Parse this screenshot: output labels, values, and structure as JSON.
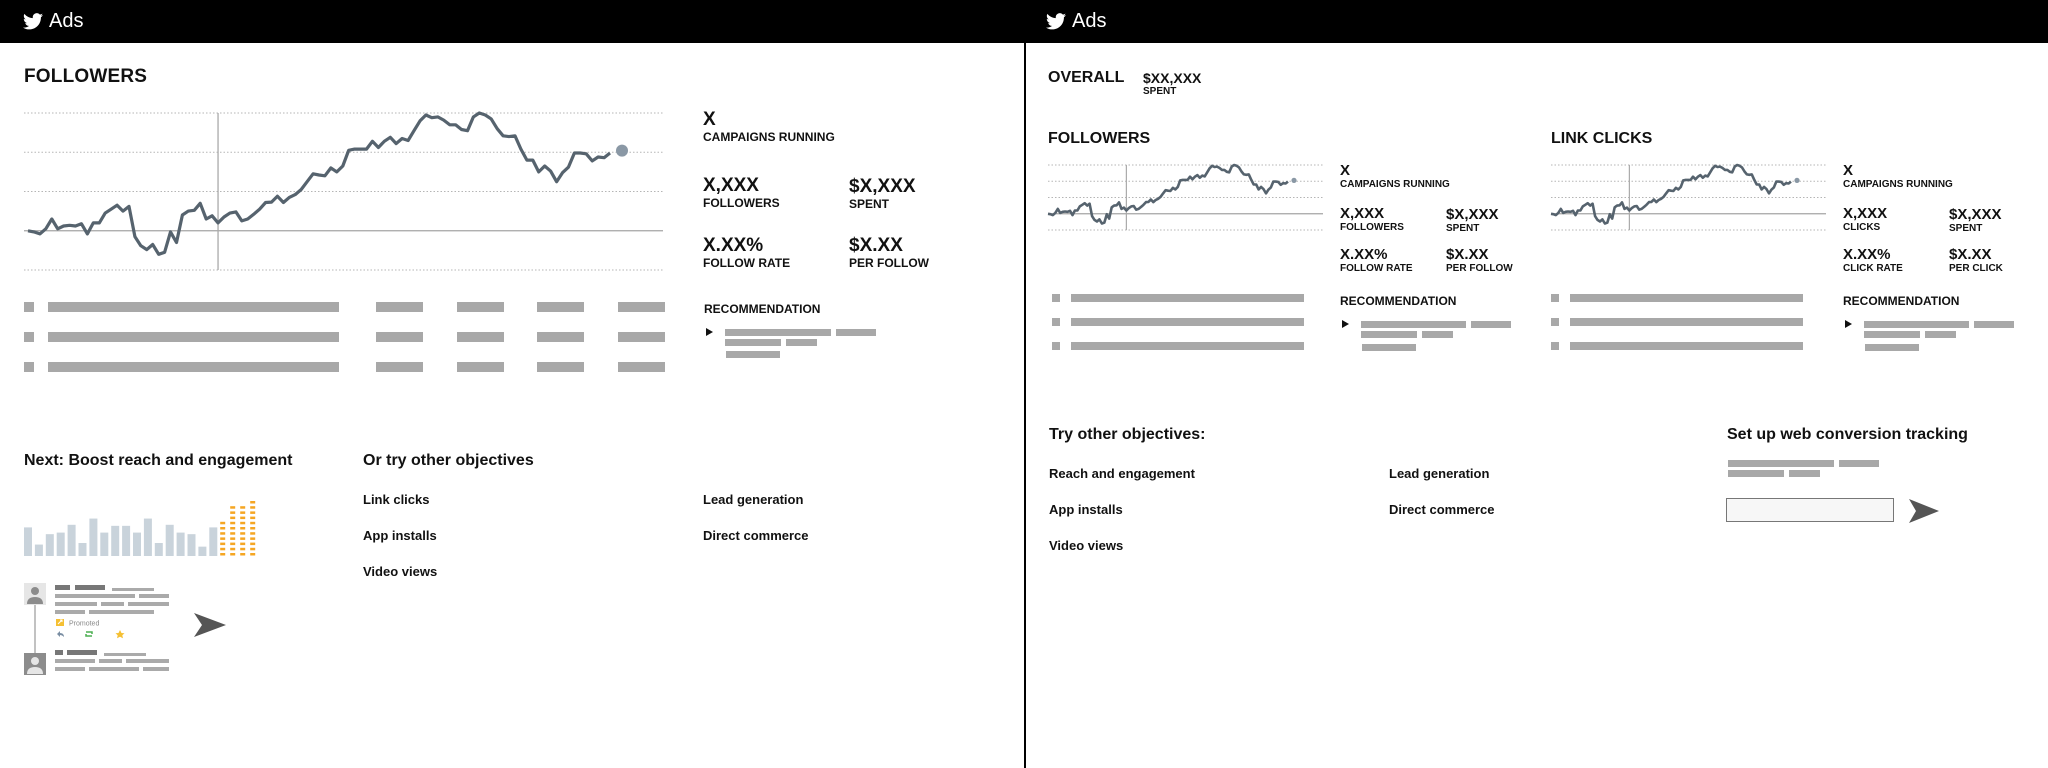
{
  "app": {
    "brand": "Ads",
    "logo_icon": "twitter-bird-icon"
  },
  "colors": {
    "line": "#56636e",
    "endpoint": "#8a98a5",
    "bar_gray": "#a8a8a8",
    "orange": "#f5a623",
    "light_bars": "#c9d3db"
  },
  "left": {
    "title": "FOLLOWERS",
    "stats": {
      "campaigns_value": "X",
      "campaigns_label": "CAMPAIGNS RUNNING",
      "followers_value": "X,XXX",
      "followers_label": "FOLLOWERS",
      "spent_value": "$X,XXX",
      "spent_label": "SPENT",
      "rate_value": "X.XX%",
      "rate_label": "FOLLOW RATE",
      "per_value": "$X.XX",
      "per_label": "PER FOLLOW"
    },
    "recommendation_title": "RECOMMENDATION",
    "next_title": "Next: Boost reach and engagement",
    "objectives_title": "Or try other objectives",
    "objectives": [
      "Link clicks",
      "App installs",
      "Video views",
      "Lead generation",
      "Direct commerce"
    ],
    "promoted_label": "Promoted"
  },
  "right": {
    "overall_label": "OVERALL",
    "overall_value": "$XX,XXX",
    "overall_sub": "SPENT",
    "followers_card": {
      "title": "FOLLOWERS",
      "campaigns_value": "X",
      "campaigns_label": "CAMPAIGNS RUNNING",
      "m1_value": "X,XXX",
      "m1_label": "FOLLOWERS",
      "m2_value": "$X,XXX",
      "m2_label": "SPENT",
      "m3_value": "X.XX%",
      "m3_label": "FOLLOW RATE",
      "m4_value": "$X.XX",
      "m4_label": "PER FOLLOW",
      "recommendation_title": "RECOMMENDATION"
    },
    "clicks_card": {
      "title": "LINK CLICKS",
      "campaigns_value": "X",
      "campaigns_label": "CAMPAIGNS RUNNING",
      "m1_value": "X,XXX",
      "m1_label": "CLICKS",
      "m2_value": "$X,XXX",
      "m2_label": "SPENT",
      "m3_value": "X.XX%",
      "m3_label": "CLICK RATE",
      "m4_value": "$X.XX",
      "m4_label": "PER CLICK",
      "recommendation_title": "RECOMMENDATION"
    },
    "objectives_title": "Try other objectives:",
    "objectives": [
      "Reach and engagement",
      "App installs",
      "Video views",
      "Lead generation",
      "Direct commerce"
    ],
    "conversion_title": "Set up web conversion tracking",
    "conversion_input_value": ""
  },
  "chart_data": [
    {
      "type": "line",
      "title": "FOLLOWERS",
      "xlabel": "",
      "ylabel": "",
      "ylim": [
        -1,
        3
      ],
      "grid": true,
      "marker_at_x": 32,
      "x": [
        0,
        1,
        2,
        3,
        4,
        5,
        6,
        7,
        8,
        9,
        10,
        11,
        12,
        13,
        14,
        15,
        16,
        17,
        18,
        19,
        20,
        21,
        22,
        23,
        24,
        25,
        26,
        27,
        28,
        29,
        30,
        31,
        32,
        33,
        34,
        35,
        36,
        37,
        38,
        39,
        40,
        41,
        42,
        43,
        44,
        45,
        46,
        47,
        48,
        49,
        50,
        51,
        52,
        53,
        54,
        55,
        56,
        57,
        58,
        59,
        60,
        61,
        62,
        63,
        64,
        65,
        66,
        67,
        68,
        69,
        70,
        71,
        72,
        73,
        74,
        75,
        76,
        77,
        78,
        79,
        80,
        81,
        82,
        83,
        84,
        85,
        86,
        87,
        88,
        89,
        90,
        91,
        92,
        93,
        94,
        95,
        96,
        97,
        98,
        99,
        100,
        101,
        102,
        103,
        104,
        105,
        106,
        107,
        108,
        109,
        110,
        111,
        112,
        113,
        114,
        115,
        116,
        117,
        118,
        119,
        120,
        121,
        122,
        123,
        124,
        125,
        126,
        127,
        128,
        129,
        130,
        131,
        132,
        133,
        134,
        135,
        136
      ],
      "series": [
        {
          "name": "Followers",
          "values": [
            0.0,
            -0.03,
            -0.08,
            0.05,
            0.3,
            0.05,
            0.12,
            0.14,
            0.12,
            0.18,
            -0.08,
            0.2,
            0.2,
            0.45,
            0.55,
            0.65,
            0.5,
            0.62,
            -0.15,
            -0.38,
            -0.48,
            -0.35,
            -0.6,
            -0.55,
            -0.03,
            -0.3,
            0.4,
            0.5,
            0.52,
            0.7,
            0.3,
            0.38,
            0.2,
            0.35,
            0.45,
            0.48,
            0.25,
            0.3,
            0.42,
            0.55,
            0.72,
            0.73,
            0.88,
            0.72,
            0.85,
            0.92,
            1.05,
            1.25,
            1.45,
            1.42,
            1.4,
            1.6,
            1.5,
            1.65,
            2.05,
            2.08,
            2.08,
            2.08,
            2.28,
            2.12,
            2.28,
            2.38,
            2.22,
            2.35,
            2.3,
            2.55,
            2.8,
            2.95,
            2.88,
            2.9,
            2.82,
            2.7,
            2.7,
            2.58,
            2.55,
            2.9,
            3.0,
            2.95,
            2.85,
            2.6,
            2.42,
            2.4,
            2.42,
            2.08,
            1.8,
            1.8,
            1.5,
            1.65,
            1.52,
            1.25,
            1.48,
            1.62,
            1.98,
            1.98,
            1.96,
            1.78,
            1.88,
            1.86,
            1.98
          ]
        }
      ]
    }
  ],
  "mini_bar_chart": {
    "gray_values": [
      0.55,
      0.22,
      0.42,
      0.45,
      0.6,
      0.25,
      0.72,
      0.45,
      0.58,
      0.58,
      0.45,
      0.72,
      0.25,
      0.6,
      0.45,
      0.42,
      0.18,
      0.55
    ],
    "orange_values": [
      0.74,
      1.0,
      0.96,
      1.1
    ]
  }
}
